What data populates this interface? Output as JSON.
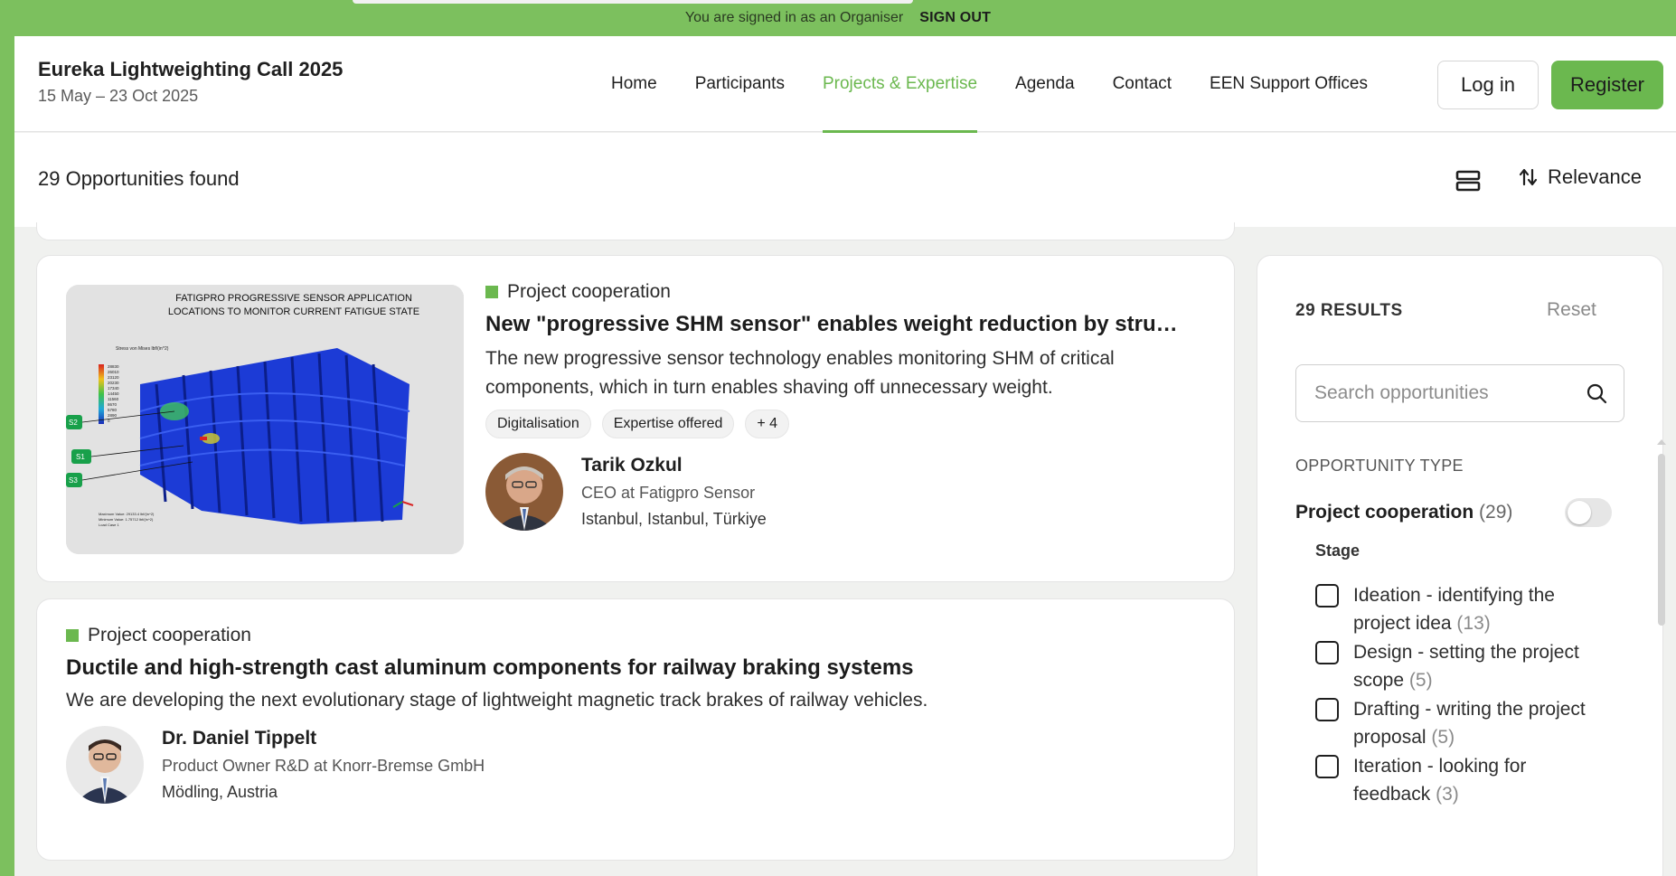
{
  "topbar": {
    "message": "You are signed in as an Organiser",
    "signout": "SIGN OUT"
  },
  "brand": {
    "title": "Eureka Lightweighting Call 2025",
    "dates": "15 May – 23 Oct 2025"
  },
  "nav": {
    "items": [
      "Home",
      "Participants",
      "Projects & Expertise",
      "Agenda",
      "Contact",
      "EEN Support Offices"
    ],
    "active": "Projects & Expertise"
  },
  "auth": {
    "login": "Log in",
    "register": "Register"
  },
  "results": {
    "count_label": "29 Opportunities found",
    "sort_label": "Relevance"
  },
  "cards": [
    {
      "type": "Project cooperation",
      "title": "New \"progressive SHM sensor\" enables weight reduction by struct...",
      "description": "The new progressive sensor technology enables monitoring SHM of critical components, which in turn enables shaving off unnecessary weight.",
      "tags": [
        "Digitalisation",
        "Expertise offered",
        "+ 4"
      ],
      "image_caption": [
        "FATIGPRO PROGRESSIVE SENSOR APPLICATION",
        "LOCATIONS TO MONITOR CURRENT FATIGUE STATE"
      ],
      "image_legend_title": "Stress von Mises lbf/(in^2)",
      "image_legend_values": [
        "28830",
        "26010",
        "23120",
        "20230",
        "17340",
        "14450",
        "11560",
        "8670",
        "5780",
        "2890",
        "0"
      ],
      "image_sensors": [
        "S2",
        "S1",
        "S3"
      ],
      "image_footnote": [
        "Maximum Value: 29133.4 lbf/(in^2)",
        "Minimum Value: 1.75712 lbf/(in^2)",
        "Load Case 1"
      ],
      "person": {
        "name": "Tarik Ozkul",
        "role": "CEO at Fatigpro Sensor",
        "location": "Istanbul, Istanbul, Türkiye"
      }
    },
    {
      "type": "Project cooperation",
      "title": "Ductile and high-strength cast aluminum components for railway braking systems",
      "description": "We are developing the next evolutionary stage of lightweight magnetic track brakes of railway vehicles.",
      "person": {
        "name": "Dr. Daniel Tippelt",
        "role": "Product Owner R&D at Knorr-Bremse GmbH",
        "location": "Mödling, Austria"
      }
    }
  ],
  "sidebar": {
    "results_label": "29 RESULTS",
    "reset": "Reset",
    "search_placeholder": "Search opportunities",
    "opportunity_type_label": "OPPORTUNITY TYPE",
    "toggle_label": "Project cooperation",
    "toggle_count": "(29)",
    "stage_label": "Stage",
    "stages": [
      {
        "label": "Ideation - identifying the project idea",
        "count": "(13)"
      },
      {
        "label": "Design - setting the project scope",
        "count": "(5)"
      },
      {
        "label": "Drafting - writing the project proposal",
        "count": "(5)"
      },
      {
        "label": "Iteration - looking for feedback",
        "count": "(3)"
      }
    ]
  },
  "colors": {
    "brand_green": "#6bb84f",
    "topbar_green": "#7cc05e",
    "background": "#f0f1ef"
  }
}
